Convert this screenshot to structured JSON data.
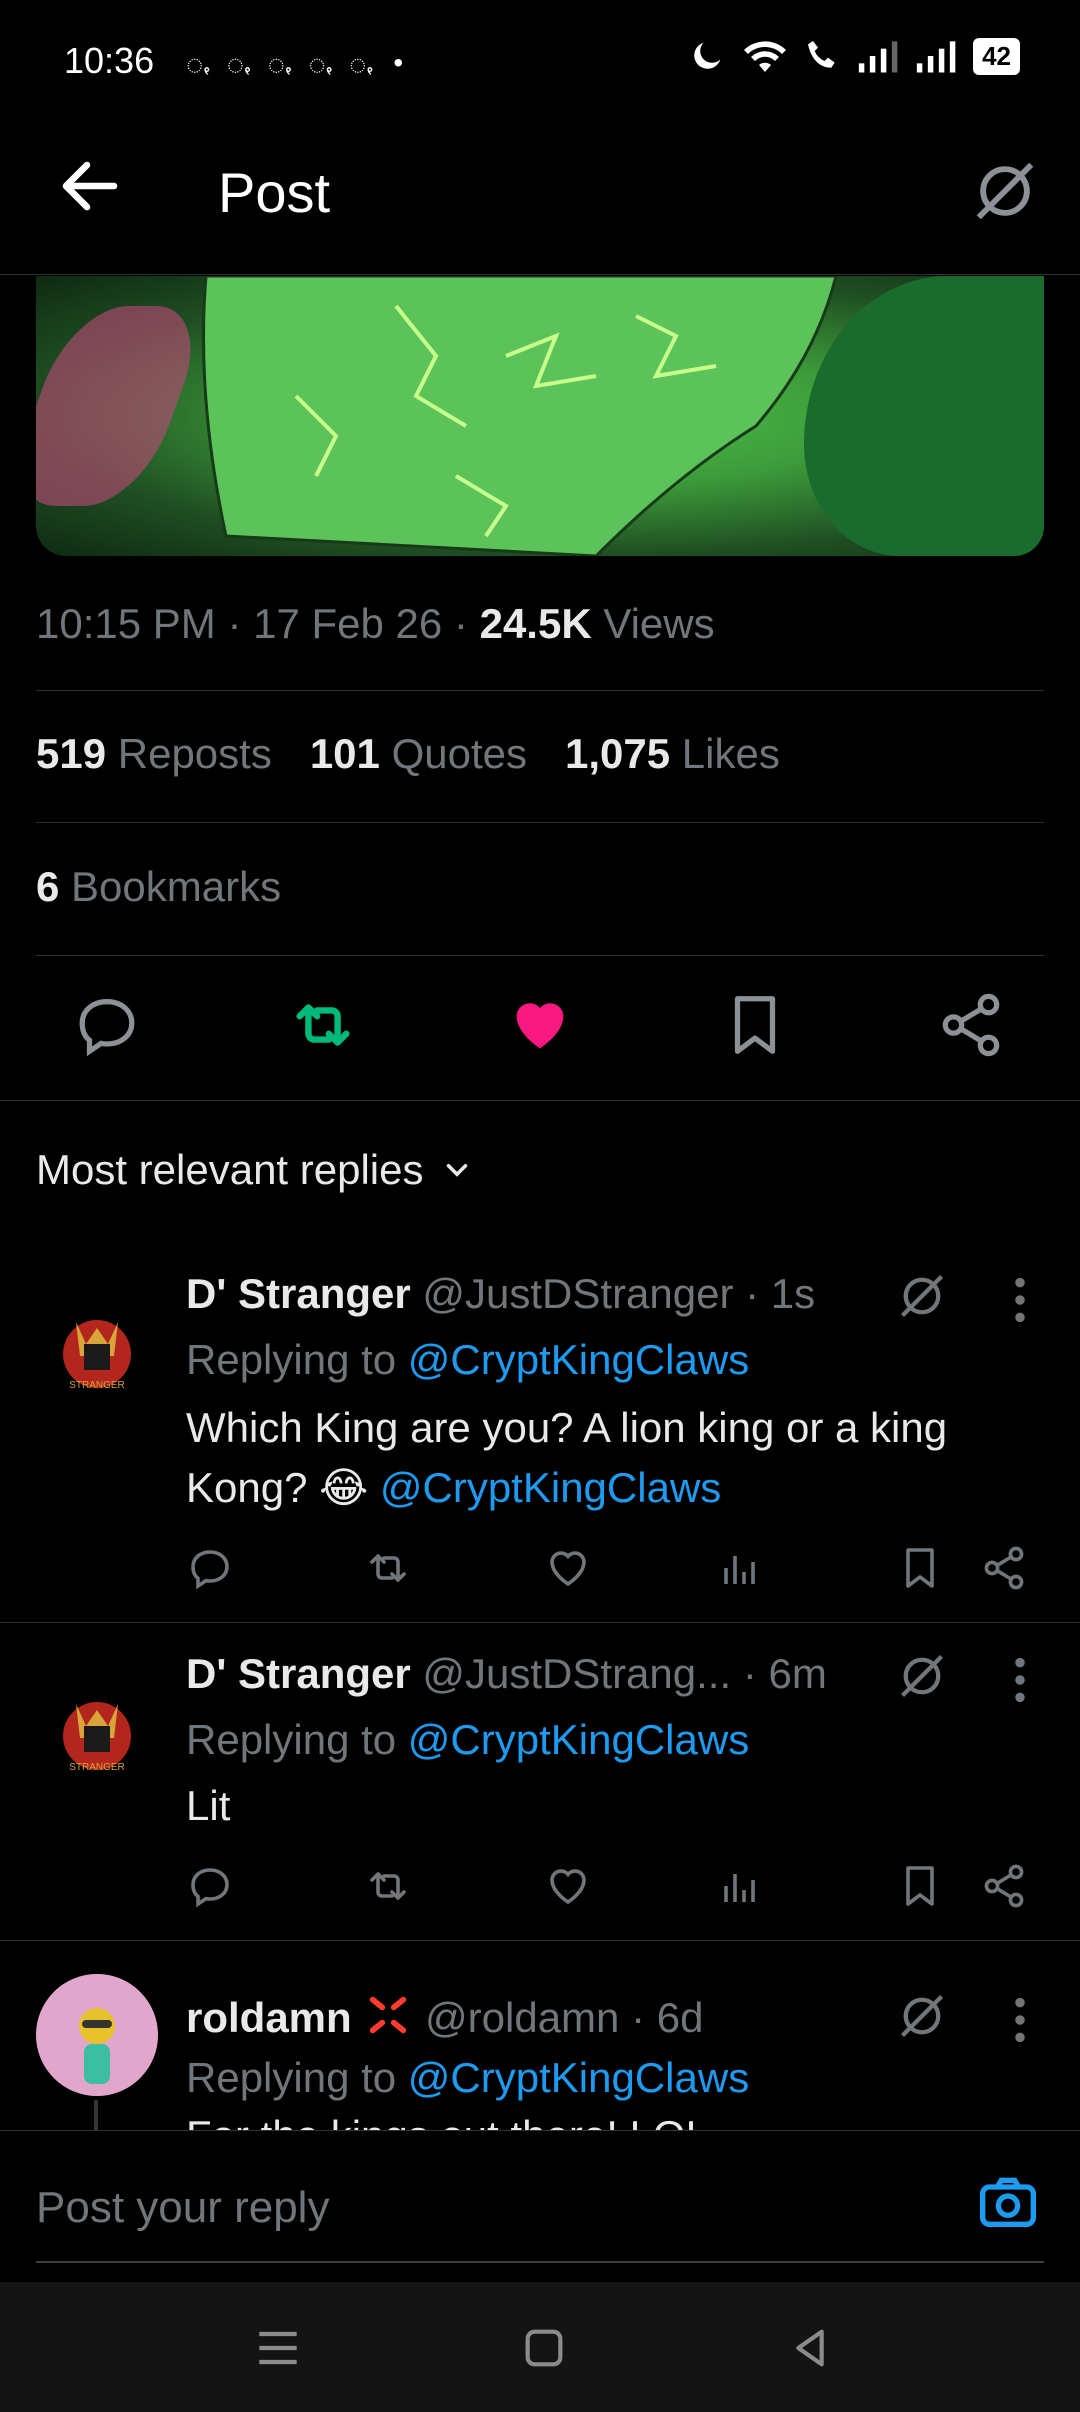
{
  "status_bar": {
    "time": "10:36",
    "notif_icons": "ꩻ ꩻ ꩻ ꩻ ꩻ •",
    "battery": "42"
  },
  "header": {
    "title": "Post"
  },
  "post": {
    "time": "10:15 PM",
    "date": "17 Feb 26",
    "views_count": "24.5K",
    "views_label": "Views",
    "reposts_count": "519",
    "reposts_label": "Reposts",
    "quotes_count": "101",
    "quotes_label": "Quotes",
    "likes_count": "1,075",
    "likes_label": "Likes",
    "bookmarks_count": "6",
    "bookmarks_label": "Bookmarks",
    "liked": true,
    "reposted": true
  },
  "replies_header": {
    "label": "Most relevant replies"
  },
  "replies": [
    {
      "name": "D' Stranger",
      "handle": "@JustDStranger",
      "time": "· 1s",
      "replying_prefix": "Replying to",
      "replying_to": "@CryptKingClaws",
      "text": "Which King are you? A lion king or a king Kong? 😂",
      "mention": "@CryptKingClaws"
    },
    {
      "name": "D' Stranger",
      "handle": "@JustDStrang...",
      "time": "· 6m",
      "replying_prefix": "Replying to",
      "replying_to": "@CryptKingClaws",
      "text": "Lit"
    },
    {
      "name": "roldamn",
      "handle": "@roldamn",
      "time": "· 6d",
      "replying_prefix": "Replying to",
      "replying_to": "@CryptKingClaws",
      "text": "For the kings out there! LOL"
    }
  ],
  "reply_input": {
    "placeholder": "Post your reply"
  },
  "colors": {
    "accent": "#1d9bf0",
    "like": "#f91880",
    "repost": "#00ba7c",
    "muted": "#71767b"
  }
}
